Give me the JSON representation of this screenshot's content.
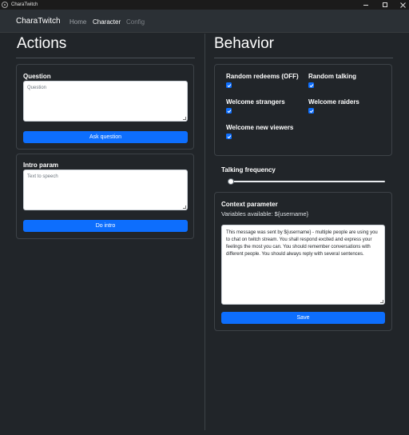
{
  "window": {
    "title": "CharaTwitch"
  },
  "nav": {
    "brand": "CharaTwitch",
    "home": "Home",
    "character": "Character",
    "config": "Config"
  },
  "actions": {
    "heading": "Actions",
    "question": {
      "label": "Question",
      "placeholder": "Question",
      "button": "Ask question"
    },
    "intro": {
      "label": "Intro param",
      "placeholder": "Text to speech",
      "button": "Do intro"
    }
  },
  "behavior": {
    "heading": "Behavior",
    "toggles": [
      {
        "label": "Random redeems (OFF)",
        "checked": true
      },
      {
        "label": "Random talking",
        "checked": true
      },
      {
        "label": "Welcome strangers",
        "checked": true
      },
      {
        "label": "Welcome raiders",
        "checked": true
      },
      {
        "label": "Welcome new viewers",
        "checked": true
      }
    ],
    "talking_frequency": {
      "label": "Talking frequency",
      "value": 0.02
    },
    "context": {
      "label": "Context parameter",
      "variables": "Variables available: ${username}",
      "value": "This message was sent by ${username} - multiple people are using you to chat on twitch stream. You shall respond excited and express your feelings the most you can. You should remember conversations with different people. You should always reply with several sentences.",
      "button": "Save"
    }
  },
  "colors": {
    "accent": "#0d6efd",
    "background": "#212529",
    "navbar": "#2b3035"
  }
}
